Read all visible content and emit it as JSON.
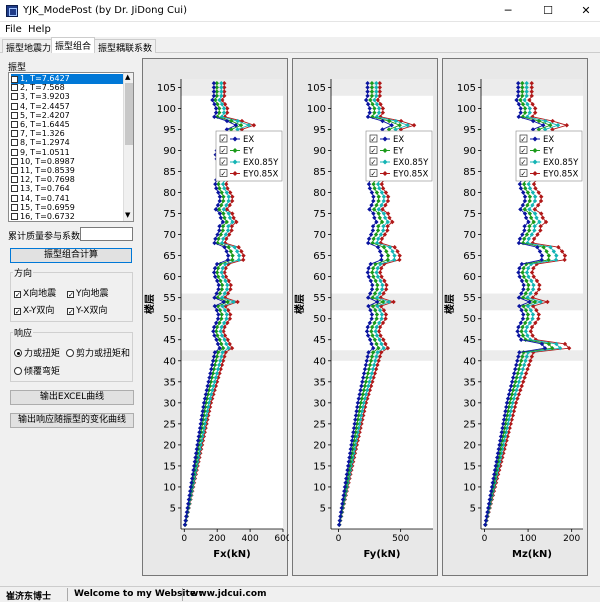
{
  "window": {
    "title": "YJK_ModePost (by Dr. JiDong Cui)",
    "minimize": "─",
    "maximize": "☐",
    "close": "✕"
  },
  "menu": {
    "file": "File",
    "help": "Help"
  },
  "tabs": [
    "振型地震力",
    "振型组合",
    "振型耦联系数"
  ],
  "left": {
    "mode_label": "振型",
    "modes": [
      {
        "label": "1, T=7.6427",
        "checked": true
      },
      {
        "label": "2, T=7.568",
        "checked": false
      },
      {
        "label": "3, T=3.9203",
        "checked": false
      },
      {
        "label": "4, T=2.4457",
        "checked": false
      },
      {
        "label": "5, T=2.4207",
        "checked": false
      },
      {
        "label": "6, T=1.6445",
        "checked": false
      },
      {
        "label": "7, T=1.326",
        "checked": false
      },
      {
        "label": "8, T=1.2974",
        "checked": false
      },
      {
        "label": "9, T=1.0511",
        "checked": false
      },
      {
        "label": "10, T=0.8987",
        "checked": false
      },
      {
        "label": "11, T=0.8539",
        "checked": false
      },
      {
        "label": "12, T=0.7698",
        "checked": false
      },
      {
        "label": "13, T=0.764",
        "checked": false
      },
      {
        "label": "14, T=0.741",
        "checked": false
      },
      {
        "label": "15, T=0.6959",
        "checked": false
      },
      {
        "label": "16, T=0.6732",
        "checked": false
      }
    ],
    "mass_label": "累计质量参与系数",
    "mass_value": "",
    "calc_button": "振型组合计算",
    "direction": {
      "title": "方向",
      "x": "X向地震",
      "y": "Y向地震",
      "xy": "X-Y双向",
      "yx": "Y-X双向"
    },
    "response": {
      "title": "响应",
      "force": "力或扭矩",
      "shear": "剪力或扭矩和",
      "overturn": "倾覆弯矩"
    },
    "excel_button": "输出EXCEL曲线",
    "curve_button": "输出响应随振型的变化曲线"
  },
  "status": {
    "author": "崔济东博士",
    "welcome": "Welcome to my Website :",
    "site": "www.jdcui.com"
  },
  "colors": {
    "EX": "#0a14a0",
    "EY": "#1a9a1a",
    "EX085": "#14b4b4",
    "EY085": "#b01818"
  },
  "charts": [
    {
      "ylabel": "楼层",
      "xlabel": "Fx(kN)",
      "xticks": [
        "0",
        "200",
        "400",
        "600"
      ],
      "xlim": [
        -20,
        600
      ]
    },
    {
      "ylabel": "楼层",
      "xlabel": "Fy(kN)",
      "xticks": [
        "0",
        "500"
      ],
      "xlim": [
        -60,
        760
      ]
    },
    {
      "ylabel": "楼层",
      "xlabel": "Mz(kN)",
      "xticks": [
        "0",
        "100",
        "200"
      ],
      "xlim": [
        -8,
        226
      ]
    }
  ],
  "yticks": [
    "5",
    "10",
    "15",
    "20",
    "25",
    "30",
    "35",
    "40",
    "45",
    "50",
    "55",
    "60",
    "65",
    "70",
    "75",
    "80",
    "85",
    "90",
    "95",
    "100",
    "105"
  ],
  "legend": [
    "EX",
    "EY",
    "EX0.85Y",
    "EY0.85X"
  ],
  "chart_data": [
    {
      "type": "line",
      "title": "",
      "xlabel": "Fx(kN)",
      "ylabel": "楼层",
      "ylim": [
        0,
        107
      ],
      "xlim": [
        -20,
        600
      ],
      "y": "floor 1-106",
      "series": [
        {
          "name": "EX",
          "values": "profile: 0 at floor 1, ~90 at 20, ~150 at 35, ~170 at 42, 180-230 from 43 to 95, peaks ~245 at 54, ~250 at 66, ~310 at 96"
        },
        {
          "name": "EY",
          "values": "profile similar to EX, about 10% higher"
        },
        {
          "name": "EX0.85Y",
          "values": "profile similar to EX, about 25% higher; peak ~540 at 96"
        },
        {
          "name": "EY0.85X",
          "values": "profile similar to EX, about 35% higher; peak ~560 at 96"
        }
      ]
    },
    {
      "type": "line",
      "title": "",
      "xlabel": "Fy(kN)",
      "ylabel": "楼层",
      "ylim": [
        0,
        107
      ],
      "xlim": [
        -60,
        760
      ],
      "y": "floor 1-106",
      "series": [
        {
          "name": "EX",
          "values": "profile rising to ~230 at 42, 250-320 from 43 to 95, peak ~400 at 96"
        },
        {
          "name": "EY",
          "values": "about 15% above EX"
        },
        {
          "name": "EX0.85Y",
          "values": "about 30% above EX"
        },
        {
          "name": "EY0.85X",
          "values": "about 40% above EX; peak ~690 at 96"
        }
      ]
    },
    {
      "type": "line",
      "title": "",
      "xlabel": "Mz(kN)",
      "ylabel": "楼层",
      "ylim": [
        0,
        107
      ],
      "xlim": [
        -8,
        226
      ],
      "y": "floor 1-106",
      "series": [
        {
          "name": "EX",
          "values": "profile rising to ~55 at 40, ~80-100 from 43 to 95, spikes ~130 at 43 and 66"
        },
        {
          "name": "EY",
          "values": "about 12% above EX"
        },
        {
          "name": "EX0.85Y",
          "values": "about 25% above EX"
        },
        {
          "name": "EY0.85X",
          "values": "about 40% above EX; peak ~210 at 44"
        }
      ]
    }
  ]
}
